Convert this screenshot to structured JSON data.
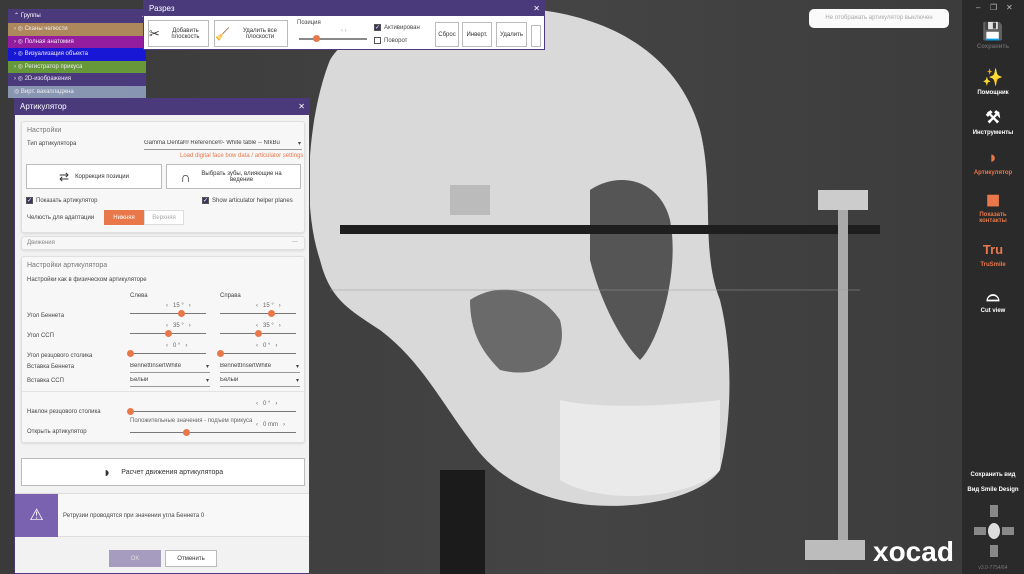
{
  "toast": "Не отображать артикулятор выключен",
  "groups": {
    "title": "Группы",
    "rows": [
      {
        "label": "Сканы челюсти",
        "color": "#b8915a"
      },
      {
        "label": "Полная анатомия",
        "color": "#9c1aa2"
      },
      {
        "label": "Визуализация объекта",
        "color": "#1414e0"
      },
      {
        "label": "Регистратор прикуса",
        "color": "#6aa232"
      },
      {
        "label": "2D-изображения",
        "color": "#4a3a7c"
      },
      {
        "label": "Вирт. вакапладжна",
        "color": "#8fa0b8"
      }
    ]
  },
  "razrez": {
    "title": "Разрез",
    "add": "Добавить плоскость",
    "remove_all": "Удалить все плоскости",
    "position_label": "Позиция",
    "position": 0.25,
    "activated": "Активирован",
    "activated_checked": true,
    "rotate": "Поворот",
    "rotate_checked": false,
    "reset": "Сброс",
    "invert": "Инверт.",
    "delete": "Удалить"
  },
  "artic": {
    "title": "Артикулятор",
    "settings": "Настройки",
    "type_label": "Тип артикулятора",
    "type_value": "Gamma Dental® Reference®- White table -- NIkBu",
    "load_link": "Load digital face bow data / articulator settings",
    "correction": "Коррекция позиции",
    "select_teeth": "Выбрать зубы, влияющие на ведение",
    "show_art": "Показать артикулятор",
    "show_planes": "Show articulator helper planes",
    "jaw_label": "Челюсть для адаптации",
    "jaw_lower": "Нижняя",
    "jaw_upper": "Верхняя",
    "movements": "Движения",
    "art_settings": "Настройки артикулятора",
    "physical": "Настройки как в физическом артикуляторе",
    "left": "Слева",
    "right": "Справа",
    "bennett": "Угол Беннета",
    "bennett_l": "15 °",
    "bennett_r": "15 °",
    "bennett_lf": 0.67,
    "bennett_rf": 0.67,
    "ssp": "Угол ССП",
    "ssp_l": "35 °",
    "ssp_r": "35 °",
    "ssp_lf": 0.5,
    "ssp_rf": 0.5,
    "incisal": "Угол резцового столика",
    "incisal_l": "0 °",
    "incisal_r": "0 °",
    "incisal_lf": 0,
    "incisal_rf": 0,
    "bennett_insert": "Вставка Беннета",
    "bennett_insert_l": "BennettInsertWhite",
    "bennett_insert_r": "BennettInsertWhite",
    "ssp_insert": "Вставка ССП",
    "ssp_insert_l": "Белый",
    "ssp_insert_r": "Белый",
    "tilt": "Наклон резцового столика",
    "tilt_v": "0 °",
    "tilt_f": 0,
    "positive_hint": "Положительные значения - подъем прикуса",
    "open_v": "0 mm",
    "open": "Открыть артикулятор",
    "open_f": 0.34,
    "calc": "Расчет движения артикулятора",
    "warning": "Ретрузии проводятся при значении угла Беннета 0",
    "ok": "OK",
    "cancel": "Отменить"
  },
  "sidebar": {
    "save": "Сохранить",
    "helper": "Помощник",
    "tools": "Инструменты",
    "articulator": "Артикулятор",
    "contacts": "Показать контакты",
    "trusmile": "TruSmile",
    "cutview": "Cut view",
    "save_view": "Сохранить вид",
    "smile_view": "Вид Smile Design",
    "version": "v3.0-7754/64"
  },
  "brand": "xocad"
}
